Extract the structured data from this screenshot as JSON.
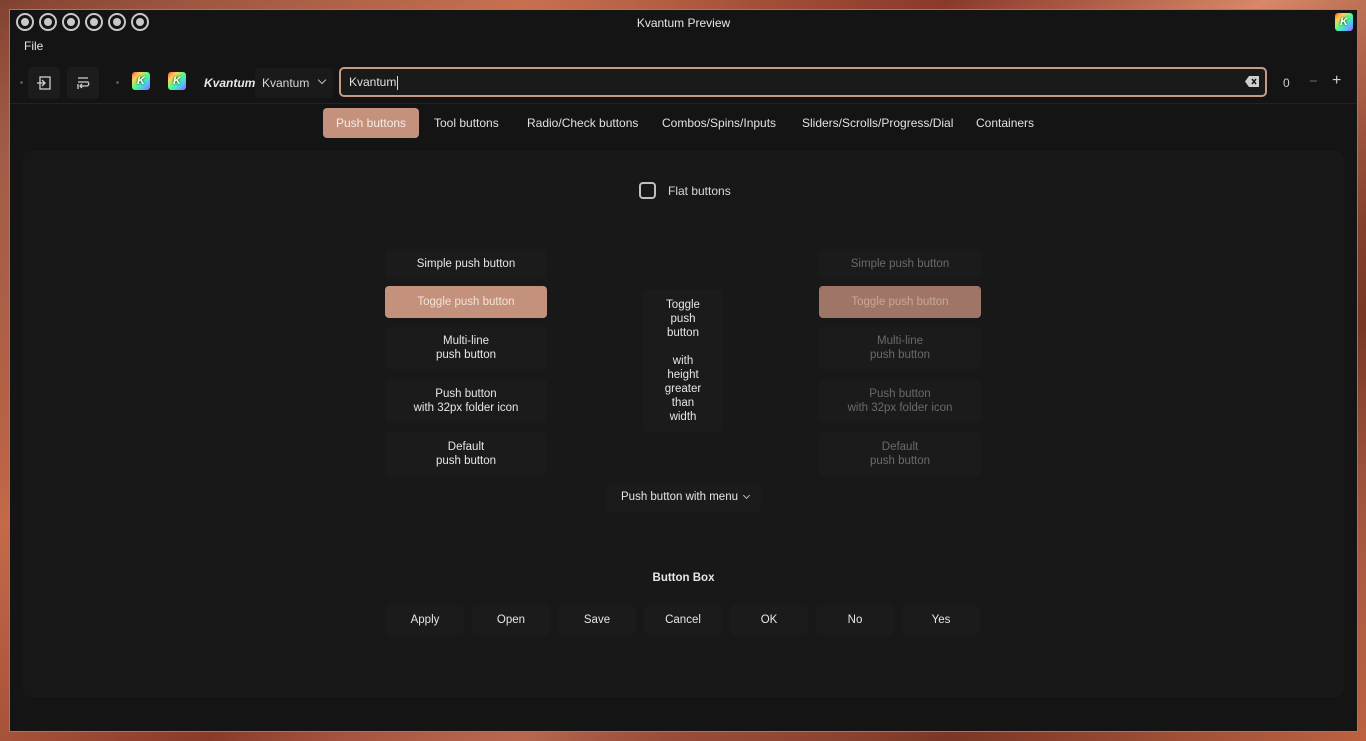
{
  "window": {
    "title": "Kvantum Preview",
    "border_color": "#6d86b8",
    "titlebar_buttons": [
      "menu-icon",
      "on-all-desktops-icon",
      "shade-icon",
      "keep-above-icon",
      "minimize-icon",
      "maximize-icon"
    ]
  },
  "menubar": {
    "file": "File"
  },
  "toolbar": {
    "brand_label": "Kvantum",
    "combo_value": "Kvantum",
    "line_edit_value": "Kvantum",
    "spin_value": "0",
    "spin_minus": "−",
    "spin_plus": "+"
  },
  "tabs": [
    {
      "label": "Push buttons",
      "active": true
    },
    {
      "label": "Tool buttons"
    },
    {
      "label": "Radio/Check buttons"
    },
    {
      "label": "Combos/Spins/Inputs"
    },
    {
      "label": "Sliders/Scrolls/Progress/Dial"
    },
    {
      "label": "Containers"
    }
  ],
  "panel": {
    "flat_buttons_label": "Flat buttons",
    "left_buttons": [
      "Simple push button",
      "Toggle push button",
      "Multi-line\npush button",
      "Push button\nwith 32px folder icon",
      "Default\npush button"
    ],
    "tall_button": "Toggle\npush\nbutton\n\nwith\nheight\ngreater\nthan\nwidth",
    "right_buttons": [
      "Simple push button",
      "Toggle push button",
      "Multi-line\npush button",
      "Push button\nwith 32px folder icon",
      "Default\npush button"
    ],
    "menu_button": "Push button with menu",
    "button_box_title": "Button Box",
    "button_box": [
      "Apply",
      "Open",
      "Save",
      "Cancel",
      "OK",
      "No",
      "Yes"
    ]
  },
  "colors": {
    "accent": "#c4917c",
    "window_bg": "#141414",
    "panel_bg": "#181818",
    "button_bg": "#1b1b1b",
    "focus_border": "#c79a84"
  }
}
